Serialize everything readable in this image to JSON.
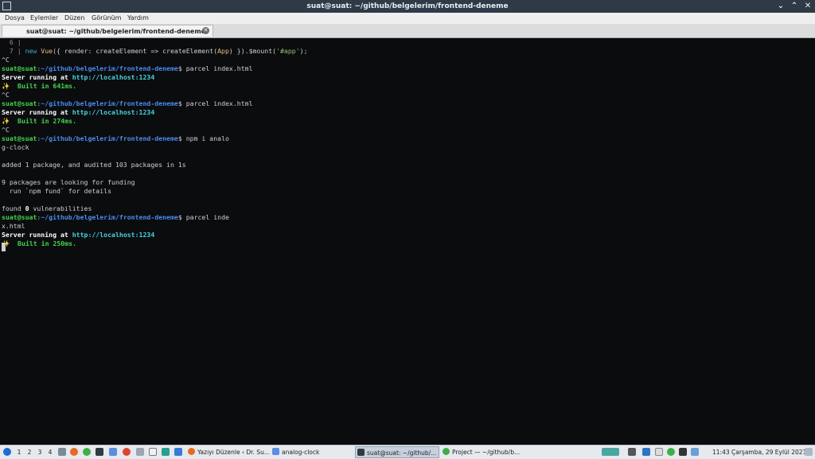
{
  "window": {
    "title": "suat@suat: ~/github/belgelerim/frontend-deneme",
    "minimize": "⌄",
    "maximize": "⌃",
    "close": "✕"
  },
  "menu": [
    "Dosya",
    "Eylemler",
    "Düzen",
    "Görünüm",
    "Yardım"
  ],
  "tab": {
    "label": "suat@suat: ~/github/belgelerim/frontend-deneme",
    "close": "✕"
  },
  "terminal": {
    "prompt_user": "suat@suat",
    "prompt_path": ":~/github/belgelerim/frontend-deneme",
    "prompt_sign": "$",
    "lines": {
      "l0_num": "  6 |",
      "l1_num": "  7 | ",
      "l1_code_new": "new ",
      "l1_code_vue": "Vue",
      "l1_code_rest": "({ render: createElement => createElement(",
      "l1_code_app": "App",
      "l1_code_end": ") }).$mount(",
      "l1_code_str": "'#app'",
      "l1_code_close": ");",
      "ctrl_c": "^C",
      "cmd1": " parcel index.html",
      "server_prefix": "Server running at ",
      "server_url": "http://localhost:1234",
      "built_icon": "✨",
      "built1": "  Built in 641ms.",
      "built2": "  Built in 274ms.",
      "built3": "  Built in 250ms.",
      "cmd3": " npm i analo",
      "cmd3_wrap": "g-clock",
      "added": "added 1 package, and audited 103 packages in 1s",
      "funding1": "9 packages are looking for funding",
      "funding2": "  run `npm fund` for details",
      "found_prefix": "found ",
      "found_zero": "0",
      "found_suffix": " vulnerabilities",
      "cmd4": " parcel inde",
      "cmd4_wrap": "x.html"
    }
  },
  "taskbar": {
    "desktops": [
      "1",
      "2",
      "3",
      "4"
    ],
    "windows": [
      "Yazıyı Düzenle ‹ Dr. Su...",
      "analog-clock",
      "suat@suat: ~/github/...",
      "Project — ~/github/b..."
    ],
    "clock": "11:43 Çarşamba, 29 Eylül 2021"
  }
}
